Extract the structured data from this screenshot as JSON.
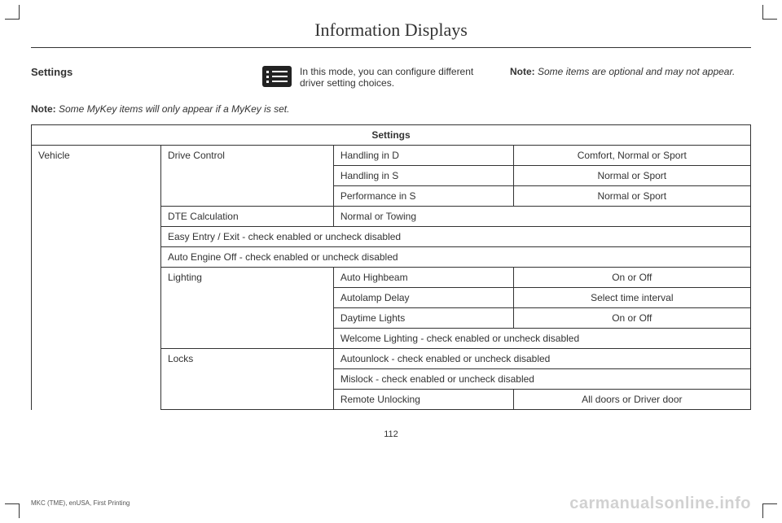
{
  "page": {
    "title": "Information Displays",
    "number": "112",
    "footer": "MKC (TME), enUSA, First Printing",
    "watermark": "carmanualsonline.info"
  },
  "intro": {
    "heading": "Settings",
    "description": "In this mode, you can configure different driver setting choices.",
    "note1_label": "Note:",
    "note1_text": " Some items are optional and may not appear.",
    "note2_label": "Note:",
    "note2_text": " Some MyKey items will only appear if a MyKey is set."
  },
  "table": {
    "header": "Settings",
    "col_vehicle": "Vehicle",
    "drive_control": "Drive Control",
    "handling_d": "Handling in D",
    "handling_d_val": "Comfort, Normal or Sport",
    "handling_s": "Handling in S",
    "handling_s_val": "Normal or Sport",
    "perf_s": "Performance in S",
    "perf_s_val": "Normal or Sport",
    "dte": "DTE Calculation",
    "dte_val": "Normal or Towing",
    "easy_entry": "Easy Entry / Exit - check enabled or uncheck disabled",
    "auto_engine": "Auto Engine Off - check enabled or uncheck disabled",
    "lighting": "Lighting",
    "auto_highbeam": "Auto Highbeam",
    "auto_highbeam_val": "On or Off",
    "autolamp": "Autolamp Delay",
    "autolamp_val": "Select time interval",
    "daytime": "Daytime Lights",
    "daytime_val": "On or Off",
    "welcome": "Welcome Lighting - check enabled or uncheck disabled",
    "locks": "Locks",
    "autounlock": "Autounlock - check enabled or uncheck disabled",
    "mislock": "Mislock - check enabled or uncheck disabled",
    "remote": "Remote Unlocking",
    "remote_val": "All doors or Driver door"
  }
}
